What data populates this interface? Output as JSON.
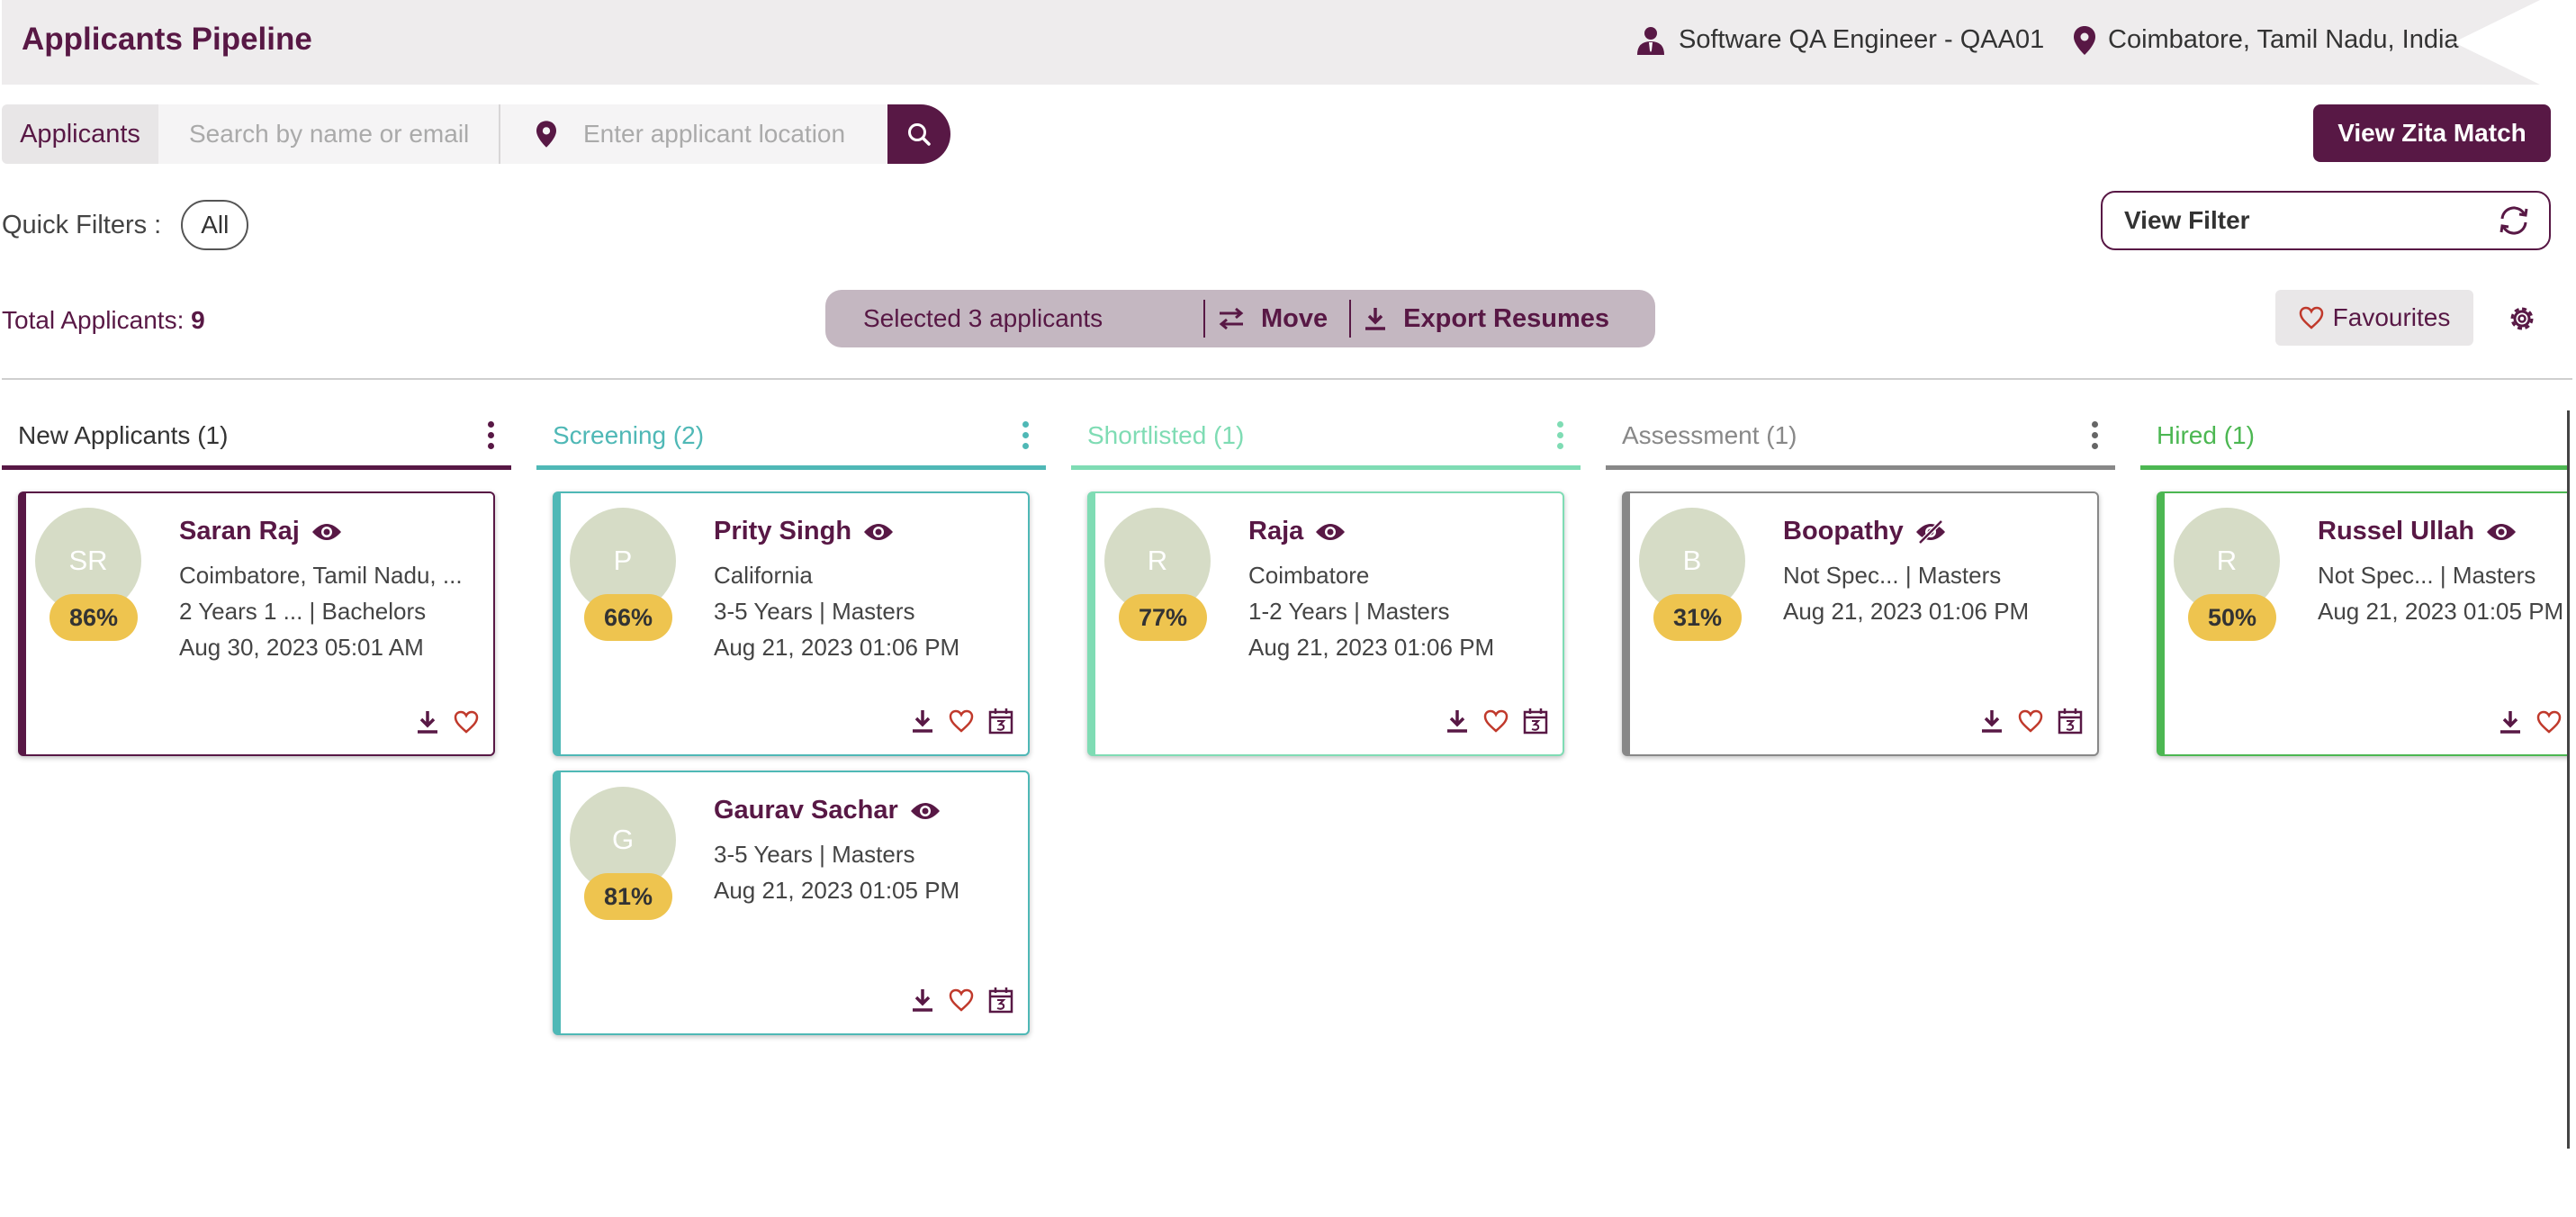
{
  "header": {
    "title": "Applicants Pipeline",
    "job": "Software QA Engineer - QAA01",
    "location": "Coimbatore, Tamil Nadu, India"
  },
  "search": {
    "label": "Applicants",
    "name_placeholder": "Search by name or email",
    "location_placeholder": "Enter applicant location"
  },
  "view_zita_match": "View Zita Match",
  "quick_filters": {
    "label": "Quick Filters :",
    "chip": "All"
  },
  "view_filter": "View Filter",
  "total": {
    "label": "Total Applicants:",
    "count": "9"
  },
  "selection": {
    "text": "Selected 3 applicants",
    "move": "Move",
    "export": "Export Resumes"
  },
  "favourites": "Favourites",
  "colors": {
    "brand": "#581845",
    "new": "#581845",
    "screening": "#4fb8b6",
    "shortlisted": "#7fdcb4",
    "assessment": "#888888",
    "hired": "#4cb752",
    "score": "#eec44f"
  },
  "columns": [
    {
      "title": "New Applicants (1)"
    },
    {
      "title": "Screening (2)"
    },
    {
      "title": "Shortlisted (1)"
    },
    {
      "title": "Assessment (1)"
    },
    {
      "title": "Hired (1)"
    }
  ],
  "cards": {
    "saran": {
      "initials": "SR",
      "score": "86%",
      "name": "Saran Raj",
      "line1": "Coimbatore, Tamil Nadu, ...",
      "line2": "2 Years 1 ...    | Bachelors",
      "date": "Aug 30, 2023 05:01 AM"
    },
    "prity": {
      "initials": "P",
      "score": "66%",
      "name": "Prity Singh",
      "line1": "California",
      "line2": "3-5 Years | Masters",
      "date": "Aug 21, 2023 01:06 PM"
    },
    "gaurav": {
      "initials": "G",
      "score": "81%",
      "name": "Gaurav Sachar",
      "line1": "3-5 Years | Masters",
      "date": "Aug 21, 2023 01:05 PM"
    },
    "raja": {
      "initials": "R",
      "score": "77%",
      "name": "Raja",
      "line1": "Coimbatore",
      "line2": "1-2 Years | Masters",
      "date": "Aug 21, 2023 01:06 PM"
    },
    "boopathy": {
      "initials": "B",
      "score": "31%",
      "name": "Boopathy",
      "line1": "Not Spec...  | Masters",
      "date": "Aug 21, 2023 01:06 PM"
    },
    "russel": {
      "initials": "R",
      "score": "50%",
      "name": "Russel Ullah",
      "line1": "Not Spec...  | Masters",
      "date": "Aug 21, 2023 01:05 PM"
    }
  },
  "icons": [
    "user-tie-icon",
    "location-pin-icon",
    "search-icon",
    "refresh-icon",
    "move-icon",
    "download-icon",
    "heart-icon",
    "settings-gear-icon",
    "eye-icon",
    "eye-slash-icon",
    "calendar-icon",
    "more-vertical-icon"
  ]
}
